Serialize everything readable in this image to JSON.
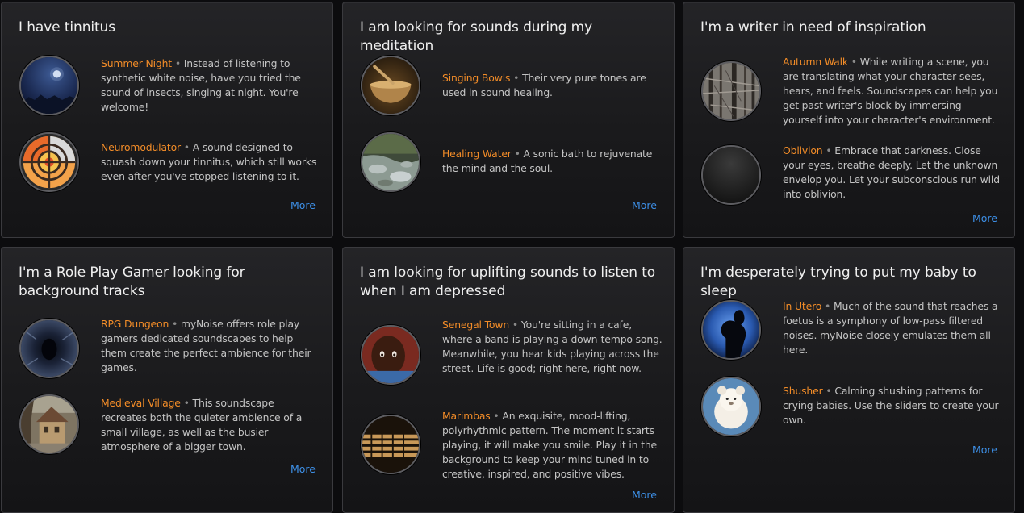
{
  "cards": [
    {
      "title": "I have tinnitus",
      "items": [
        {
          "name": "Summer Night",
          "text": "Instead of listening to synthetic white noise, have you tried the sound of insects, singing at night. You're welcome!"
        },
        {
          "name": "Neuromodulator",
          "text": "A sound designed to squash down your tinnitus, which still works even after you've stopped listening to it."
        }
      ],
      "more": "More"
    },
    {
      "title": "I am looking for sounds during my meditation",
      "items": [
        {
          "name": "Singing Bowls",
          "text": "Their very pure tones are used in sound healing."
        },
        {
          "name": "Healing Water",
          "text": "A sonic bath to rejuvenate the mind and the soul."
        }
      ],
      "more": "More"
    },
    {
      "title": "I'm a writer in need of inspiration",
      "items": [
        {
          "name": "Autumn Walk",
          "text": "While writing a scene, you are translating what your character sees, hears, and feels. Soundscapes can help you get past writer's block by immersing yourself into your character's environment."
        },
        {
          "name": "Oblivion",
          "text": "Embrace that darkness. Close your eyes, breathe deeply. Let the unknown envelop you. Let your subconscious run wild into oblivion."
        }
      ],
      "more": "More"
    },
    {
      "title": "I'm a Role Play Gamer looking for background tracks",
      "items": [
        {
          "name": "RPG Dungeon",
          "text": "myNoise offers role play gamers dedicated soundscapes to help them create the perfect ambience for their games."
        },
        {
          "name": "Medieval Village",
          "text": "This soundscape recreates both the quieter ambience of a small village, as well as the busier atmosphere of a bigger town."
        }
      ],
      "more": "More"
    },
    {
      "title": "I am looking for uplifting sounds to listen to when I am depressed",
      "items": [
        {
          "name": "Senegal Town",
          "text": "You're sitting in a cafe, where a band is playing a down-tempo song. Meanwhile, you hear kids playing across the street. Life is good; right here, right now."
        },
        {
          "name": "Marimbas",
          "text": "An exquisite, mood-lifting, polyrhythmic pattern. The moment it starts playing, it will make you smile. Play it in the background to keep your mind tuned in to creative, inspired, and positive vibes."
        }
      ],
      "more": "More"
    },
    {
      "title": "I'm desperately trying to put my baby to sleep",
      "items": [
        {
          "name": "In Utero",
          "text": "Much of the sound that reaches a foetus is a symphony of low-pass filtered noises. myNoise closely emulates them all here."
        },
        {
          "name": "Shusher",
          "text": "Calming shushing patterns for crying babies. Use the sliders to create your own."
        }
      ],
      "more": "More"
    }
  ],
  "separator": "•",
  "colors": {
    "accent_name": "#f28c28",
    "link": "#3d8fe6",
    "title": "#efefef"
  }
}
